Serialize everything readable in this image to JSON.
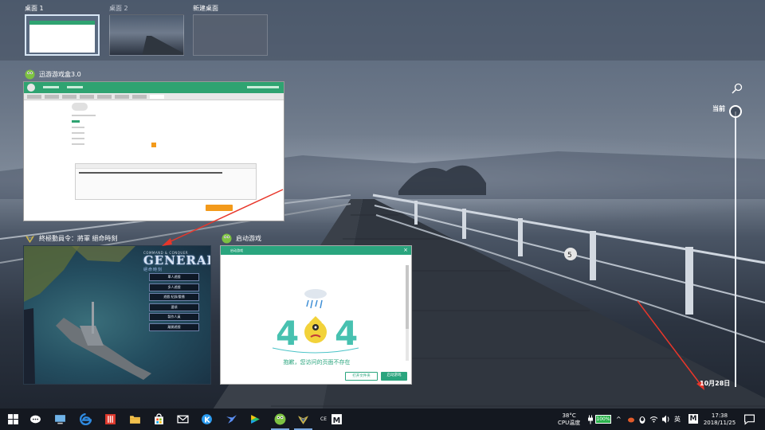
{
  "desktops": [
    {
      "label": "桌面 1",
      "active": true
    },
    {
      "label": "桌面 2",
      "active": false
    },
    {
      "label": "新建桌面",
      "active": false
    }
  ],
  "windows": {
    "gamebox": {
      "title": "迅游游戏盒3.0"
    },
    "generals": {
      "title": "終極動員令：將軍 絕命時刻",
      "logo_sub": "COMMAND & CONQUER",
      "logo_main": "GENERALS",
      "logo_zh": "絕命時刻",
      "menu": [
        "單人遊戲",
        "多人遊戲",
        "遊戲 紀錄/重播",
        "選項",
        "製作人員",
        "離開遊戲"
      ]
    },
    "launch": {
      "title": "启动游戏",
      "header": "启动游戏",
      "message": "抱歉，您访问的页面不存在",
      "btn_open": "打开文件夹",
      "btn_launch": "启动游戏"
    }
  },
  "timeline": {
    "now_label": "当前",
    "date_label": "10月28日"
  },
  "taskbar": {
    "temp": "38°C",
    "temp_label": "CPU温度",
    "battery": "100%",
    "lang": "英",
    "ime": "M",
    "time": "17:38",
    "date": "2018/11/25",
    "tray_small": "CE"
  },
  "colors": {
    "accent_green": "#2aa57e",
    "orange": "#f39a1b",
    "taskbar": "#141820",
    "arrow_red": "#e8362a"
  }
}
